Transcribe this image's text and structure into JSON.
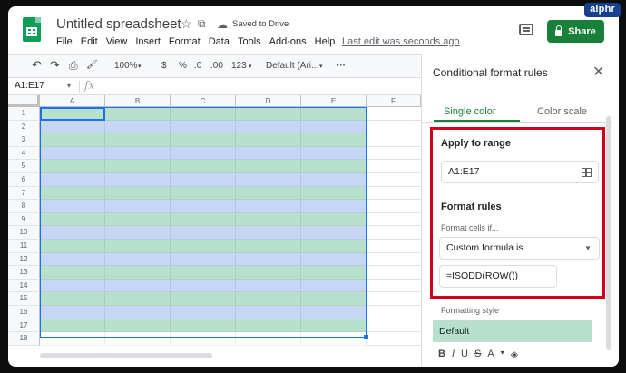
{
  "watermark": "alphr",
  "header": {
    "doc_title": "Untitled spreadsheet",
    "saved_status": "Saved to Drive",
    "menu": [
      "File",
      "Edit",
      "View",
      "Insert",
      "Format",
      "Data",
      "Tools",
      "Add-ons",
      "Help"
    ],
    "last_edit": "Last edit was seconds ago",
    "share_label": "Share",
    "star_icon": "star-icon",
    "move_icon": "folder-move-icon",
    "cloud_icon": "cloud-done-icon"
  },
  "toolbar": {
    "undo_icon": "↶",
    "redo_icon": "↷",
    "print_icon": "⎙",
    "paint_icon": "🖌",
    "zoom": "100%",
    "currency": "$",
    "percent": "%",
    "dec_less": ".0",
    "dec_more": ".00",
    "number_format": "123",
    "font": "Default (Ari...",
    "more": "···"
  },
  "formula_bar": {
    "name_box": "A1:E17",
    "fx": "fx",
    "value": ""
  },
  "grid": {
    "columns": [
      "A",
      "B",
      "C",
      "D",
      "E",
      "F"
    ],
    "rows": [
      "1",
      "2",
      "3",
      "4",
      "5",
      "6",
      "7",
      "8",
      "9",
      "10",
      "11",
      "12",
      "13",
      "14",
      "15",
      "16",
      "17",
      "18"
    ],
    "odd_row_color": "#b7e1cd",
    "even_row_color": "#c6d6f5",
    "selection_color": "#1a73e8"
  },
  "panel": {
    "title": "Conditional format rules",
    "tabs": [
      "Single color",
      "Color scale"
    ],
    "active_tab": "Single color",
    "apply_label": "Apply to range",
    "range_value": "A1:E17",
    "format_rules_label": "Format rules",
    "format_cells_if": "Format cells if...",
    "condition": "Custom formula is",
    "formula": "=ISODD(ROW())",
    "formatting_style_label": "Formatting style",
    "style_preview": "Default",
    "style_tools": [
      "B",
      "I",
      "U",
      "S",
      "A",
      "▾"
    ],
    "highlight_color": "#d0021b",
    "accent_color": "#188038"
  }
}
